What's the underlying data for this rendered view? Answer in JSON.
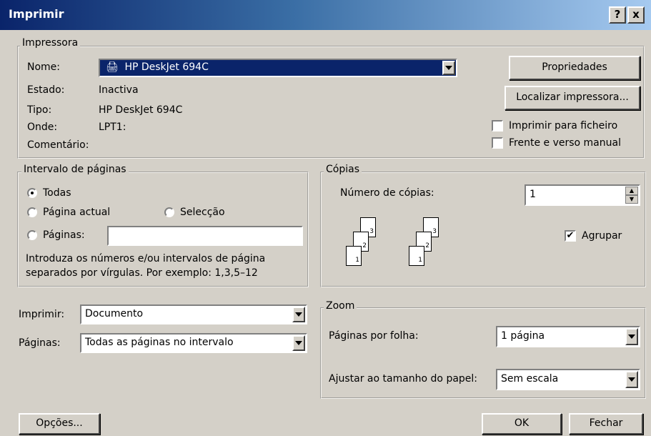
{
  "window": {
    "title": "Imprimir",
    "help_btn": "?",
    "close_btn": "x"
  },
  "printer": {
    "legend": "Impressora",
    "name_label": "Nome:",
    "name_value": "HP DeskJet 694C",
    "status_label": "Estado:",
    "status_value": "Inactiva",
    "type_label": "Tipo:",
    "type_value": "HP DeskJet 694C",
    "where_label": "Onde:",
    "where_value": "LPT1:",
    "comment_label": "Comentário:",
    "properties_button": "Propriedades",
    "find_button": "Localizar impressora...",
    "print_to_file": "Imprimir para ficheiro",
    "print_to_file_checked": false,
    "manual_duplex": "Frente e verso manual",
    "manual_duplex_checked": false
  },
  "page_range": {
    "legend": "Intervalo de páginas",
    "all": "Todas",
    "current": "Página actual",
    "selection": "Selecção",
    "pages": "Páginas:",
    "pages_value": "",
    "selected": "all",
    "hint_line1": "Introduza os números e/ou intervalos de página",
    "hint_line2": "separados por vírgulas. Por exemplo: 1,3,5–12"
  },
  "copies": {
    "legend": "Cópias",
    "number_label": "Número de cópias:",
    "number_value": "1",
    "collate_label": "Agrupar",
    "collate_checked": true,
    "stack_labels": [
      "3",
      "2",
      "1"
    ]
  },
  "print_what": {
    "label": "Imprimir:",
    "value": "Documento",
    "pages_label": "Páginas:",
    "pages_value": "Todas as páginas no intervalo"
  },
  "zoom": {
    "legend": "Zoom",
    "per_sheet_label": "Páginas por folha:",
    "per_sheet_value": "1 página",
    "scale_label": "Ajustar ao tamanho do papel:",
    "scale_value": "Sem escala"
  },
  "footer": {
    "options_button": "Opções...",
    "ok_button": "OK",
    "close_button": "Fechar"
  }
}
